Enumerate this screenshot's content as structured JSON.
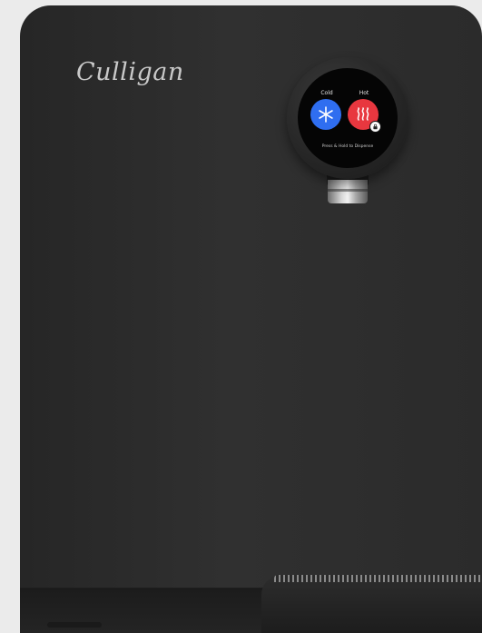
{
  "brand": {
    "logo_text": "Culligan"
  },
  "dispenser": {
    "cold_label": "Cold",
    "hot_label": "Hot",
    "instruction": "Press & Hold to Dispense",
    "cold_icon": "snowflake-icon",
    "hot_icon": "steam-icon",
    "lock_icon": "lock-icon",
    "colors": {
      "cold": "#2f6ef0",
      "hot": "#e8373f",
      "body": "#2b2b2b",
      "background": "#ebebeb"
    }
  }
}
